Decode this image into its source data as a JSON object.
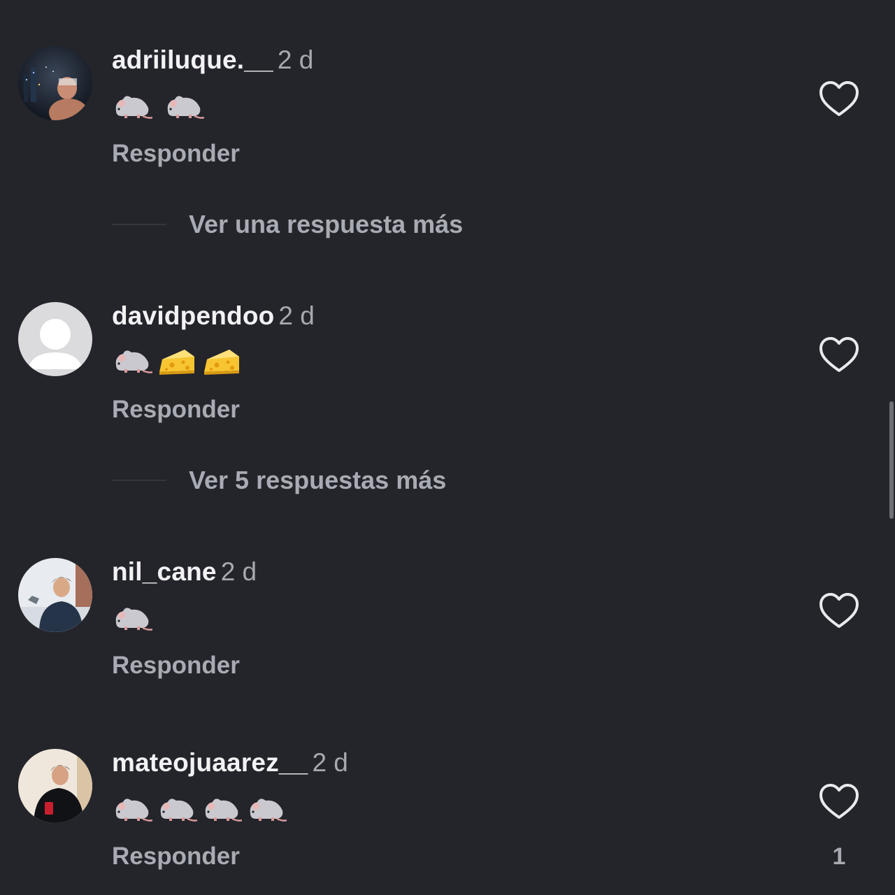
{
  "comments": [
    {
      "username": "adriiluque.__",
      "time": "2 d",
      "emojis": [
        "rat",
        "rat"
      ],
      "reply_label": "Responder",
      "more_replies": "Ver una respuesta más",
      "avatar": "photo-night-city"
    },
    {
      "username": "davidpendoo",
      "time": "2 d",
      "emojis": [
        "rat",
        "cheese",
        "cheese"
      ],
      "reply_label": "Responder",
      "more_replies": "Ver 5 respuestas más",
      "avatar": "default-placeholder"
    },
    {
      "username": "nil_cane",
      "time": "2 d",
      "emojis": [
        "rat"
      ],
      "reply_label": "Responder",
      "avatar": "photo-outdoor-jacket"
    },
    {
      "username": "mateojuaarez__",
      "time": "2 d",
      "emojis": [
        "rat",
        "rat",
        "rat",
        "rat"
      ],
      "reply_label": "Responder",
      "like_count": "1",
      "avatar": "photo-mirror-selfie"
    }
  ],
  "icons": {
    "like": "heart-outline-icon",
    "rat": "rat-emoji",
    "cheese": "cheese-emoji"
  },
  "colors": {
    "background": "#24252b",
    "username": "#f2f2f4",
    "secondary_text": "#a8abb3"
  }
}
